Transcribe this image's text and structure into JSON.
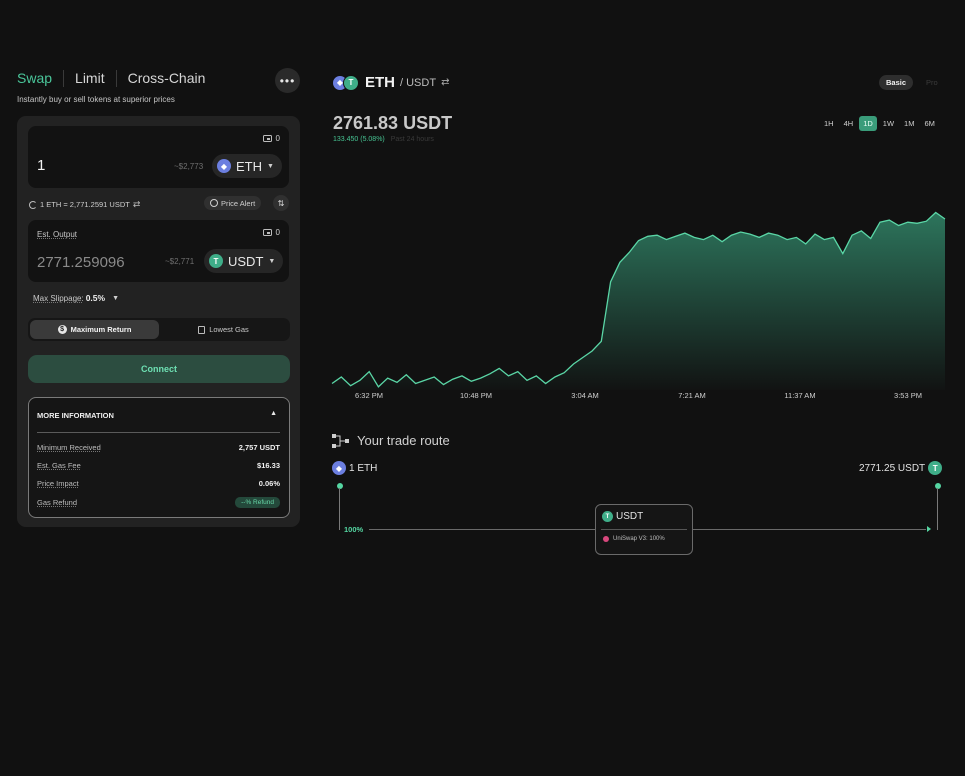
{
  "tabs": [
    {
      "label": "Swap",
      "active": true
    },
    {
      "label": "Limit",
      "active": false
    },
    {
      "label": "Cross-Chain",
      "active": false
    }
  ],
  "more_button": "•••",
  "subtitle": "Instantly buy or sell tokens at superior prices",
  "input": {
    "balance": "0",
    "amount": "1",
    "usd_value": "~$2,773",
    "token": "ETH"
  },
  "rate": {
    "text": "1 ETH = 2,771.2591 USDT",
    "price_alert_label": "Price Alert",
    "flip_icon": "⇅"
  },
  "output": {
    "label": "Est. Output",
    "balance": "0",
    "amount": "2771.259096",
    "usd_value": "~$2,771",
    "token": "USDT"
  },
  "slippage": {
    "label": "Max Slippage:",
    "value": "0.5%"
  },
  "modes": [
    {
      "label": "Maximum Return",
      "active": true,
      "icon": "dollar-icon"
    },
    {
      "label": "Lowest Gas",
      "active": false,
      "icon": "gas-pump-icon"
    }
  ],
  "connect_label": "Connect",
  "more_info": {
    "title": "MORE INFORMATION",
    "rows": [
      {
        "key": "Minimum Received",
        "value": "2,757 USDT"
      },
      {
        "key": "Est. Gas Fee",
        "value": "$16.33"
      },
      {
        "key": "Price Impact",
        "value": "0.06%"
      },
      {
        "key": "Gas Refund",
        "value": "--% Refund"
      }
    ]
  },
  "pair": {
    "base": "ETH",
    "quote": "/ USDT"
  },
  "view_toggle": [
    "Basic",
    "Pro"
  ],
  "price": "2761.83 USDT",
  "change": {
    "value": "133.450 (5.08%)",
    "period": "Past 24 hours"
  },
  "ranges": [
    {
      "label": "1H",
      "active": false
    },
    {
      "label": "4H",
      "active": false
    },
    {
      "label": "1D",
      "active": true
    },
    {
      "label": "1W",
      "active": false
    },
    {
      "label": "1M",
      "active": false
    },
    {
      "label": "6M",
      "active": false
    }
  ],
  "colors": {
    "accent": "#4ac69a",
    "line": "#5ad6a6",
    "fill_top": "#2e7a60",
    "background": "#111111"
  },
  "chart_data": {
    "type": "area",
    "title": "",
    "xlabel": "",
    "ylabel": "",
    "x_ticks": [
      "6:32 PM",
      "10:48 PM",
      "3:04 AM",
      "7:21 AM",
      "11:37 AM",
      "3:53 PM"
    ],
    "ylim": [
      2600,
      2770
    ],
    "series": [
      {
        "values": [
          2606,
          2612,
          2604,
          2609,
          2617,
          2603,
          2611,
          2607,
          2614,
          2606,
          2609,
          2612,
          2605,
          2610,
          2613,
          2608,
          2611,
          2615,
          2620,
          2613,
          2617,
          2609,
          2613,
          2606,
          2612,
          2616,
          2624,
          2630,
          2636,
          2645,
          2700,
          2718,
          2727,
          2738,
          2742,
          2743,
          2739,
          2742,
          2745,
          2741,
          2739,
          2743,
          2737,
          2743,
          2746,
          2744,
          2741,
          2745,
          2743,
          2739,
          2741,
          2735,
          2744,
          2739,
          2741,
          2726,
          2743,
          2747,
          2740,
          2755,
          2757,
          2752,
          2755,
          2754,
          2756,
          2764,
          2758
        ]
      }
    ]
  },
  "route": {
    "title": "Your trade route",
    "from": "1 ETH",
    "to": "2771.25 USDT",
    "percent": "100%",
    "hop_token": "USDT",
    "pool": "UniSwap V3: 100%"
  }
}
